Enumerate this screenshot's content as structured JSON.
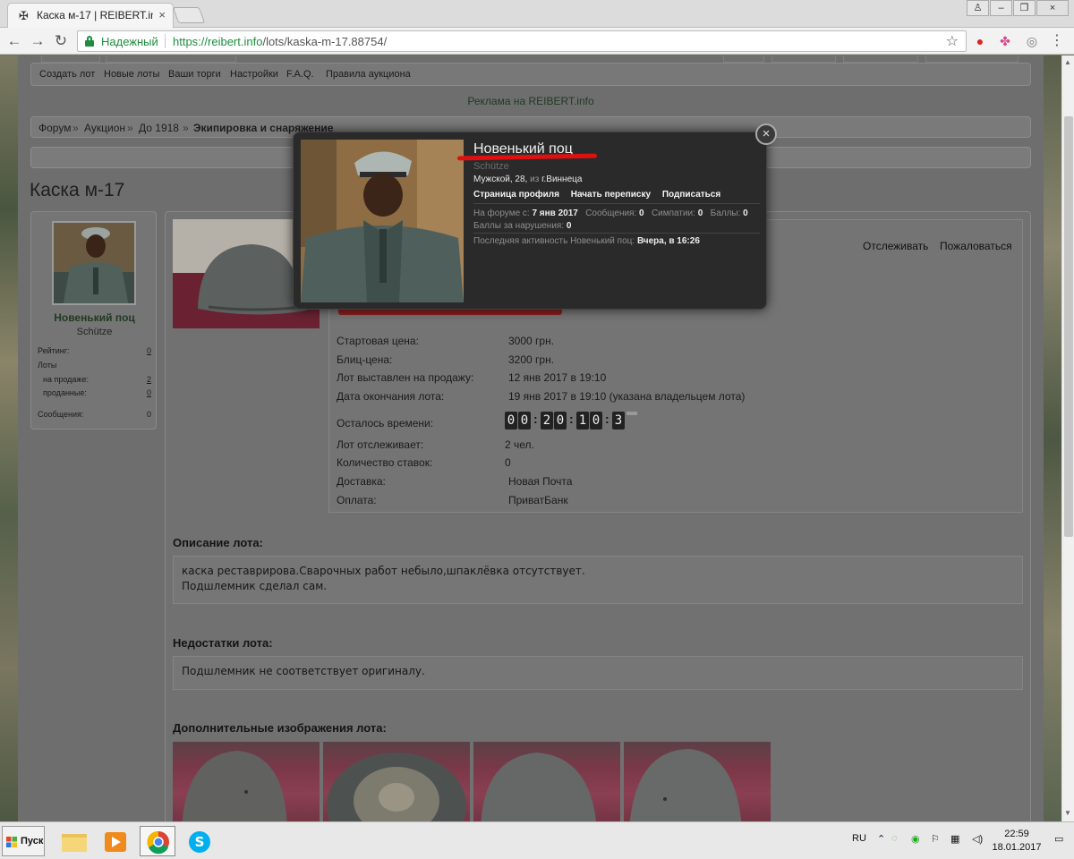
{
  "browser": {
    "tab_title": "Каска м-17 | REIBERT.info",
    "tab_close": "×",
    "omnibox_secure_label": "Надежный",
    "url_scheme_host": "https://reibert.info",
    "url_path": "/lots/kaska-m-17.88754/"
  },
  "subnav": {
    "items": [
      "Создать лот",
      "Новые лоты",
      "Ваши торги",
      "Настройки",
      "F.A.Q.",
      "Правила аукциона"
    ]
  },
  "ad_text": "Реклама на REIBERT.info",
  "breadcrumb": {
    "items": [
      "Форум",
      "Аукцион",
      "До 1918"
    ],
    "separator": "»",
    "current": "Экипировка и снаряжение"
  },
  "page_title": "Каска м-17",
  "user_card": {
    "name": "Новенький поц",
    "rank": "Schütze",
    "rating_label": "Рейтинг:",
    "rating_value": "0",
    "lots_label": "Лоты",
    "on_sale_label": "на продаже:",
    "on_sale_value": "2",
    "sold_label": "проданные:",
    "sold_value": "0",
    "messages_label": "Сообщения:",
    "messages_value": "0"
  },
  "lot": {
    "watch_link": "Отслеживать",
    "report_link": "Пожаловаться",
    "fields": [
      {
        "label": "Стартовая цена:",
        "value": "3000 грн."
      },
      {
        "label": "Блиц-цена:",
        "value": "3200 грн."
      },
      {
        "label": "Лот выставлен на продажу:",
        "value": "12 янв 2017 в 19:10"
      },
      {
        "label": "Дата окончания лота:",
        "value": "19 янв 2017 в 19:10 (указана владельцем лота)"
      }
    ],
    "time_left_label": "Осталось времени:",
    "time_left_digits": [
      "0",
      "0",
      "2",
      "0",
      "1",
      "0",
      "3"
    ],
    "fields2": [
      {
        "label": "Лот отслеживает:",
        "value": "2 чел."
      },
      {
        "label": "Количество ставок:",
        "value": "0"
      },
      {
        "label": "Доставка:",
        "value": "Новая Почта"
      },
      {
        "label": "Оплата:",
        "value": "ПриватБанк"
      }
    ],
    "description_heading": "Описание лота:",
    "description_lines": [
      "каска реставрирова.Сварочных работ небыло,шпаклёвка отсутствует.",
      "Подшлемник сделал сам."
    ],
    "flaws_heading": "Недостатки лота:",
    "flaws_text": "Подшлемник не соответствует оригиналу.",
    "extra_images_heading": "Дополнительные изображения лота:"
  },
  "member_popup": {
    "name": "Новенький поц",
    "rank": "Schütze",
    "gender_age": "Мужской, 28,",
    "from_word": "из",
    "city": "г.Виннеца",
    "links": [
      "Страница профиля",
      "Начать переписку",
      "Подписаться"
    ],
    "since_label": "На форуме с:",
    "since_value": "7 янв 2017",
    "messages_label": "Сообщения:",
    "messages_value": "0",
    "likes_label": "Симпатии:",
    "likes_value": "0",
    "points_label": "Баллы:",
    "points_value": "0",
    "warn_label": "Баллы за нарушения:",
    "warn_value": "0",
    "last_activity_label": "Последняя активность Новенький поц:",
    "last_activity_value": "Вчера, в 16:26",
    "close": "×"
  },
  "taskbar": {
    "start_label": "Пуск",
    "lang": "RU",
    "time": "22:59",
    "date": "18.01.2017"
  }
}
